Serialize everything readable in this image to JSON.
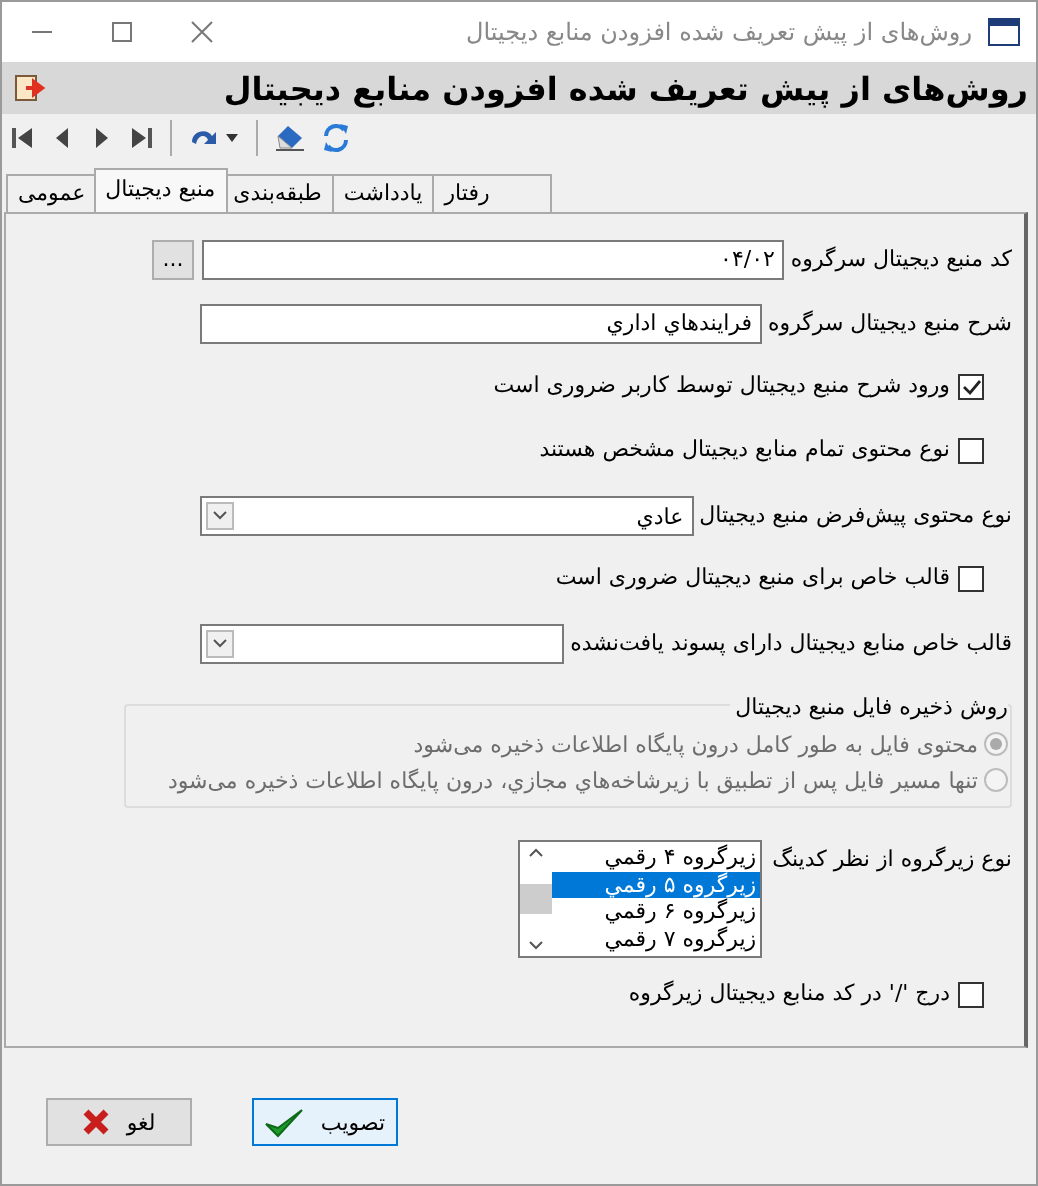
{
  "window": {
    "title": "روش‌های از پیش تعریف شده افزودن منابع دیجیتال"
  },
  "header": {
    "title": "روش‌های از پیش تعریف شده افزودن منابع دیجیتال"
  },
  "tabs": [
    {
      "label": "رفتار",
      "selected": false
    },
    {
      "label": "یادداشت",
      "selected": false
    },
    {
      "label": "طبقه‌بندی",
      "selected": false
    },
    {
      "label": "منبع دیجیتال",
      "selected": true
    },
    {
      "label": "عمومی",
      "selected": false
    }
  ],
  "fields": [
    {
      "kind": "text",
      "label": "کد منبع دیجیتال سرگروه",
      "value": "۰۴/۰۲",
      "browse": "..."
    },
    {
      "kind": "text",
      "label": "شرح منبع دیجیتال سرگروه",
      "value": "فرایندهاي اداري"
    },
    {
      "kind": "checkbox",
      "label": "ورود شرح منبع دیجیتال توسط کاربر ضروری است",
      "checked": true
    },
    {
      "kind": "checkbox",
      "label": "نوع محتوی تمام منابع دیجیتال مشخص هستند",
      "checked": false
    },
    {
      "kind": "combo",
      "label": "نوع محتوی پیش‌فرض منبع دیجیتال",
      "value": "عادي"
    },
    {
      "kind": "checkbox",
      "label": "قالب خاص برای منبع دیجیتال ضروری است",
      "checked": false
    },
    {
      "kind": "combo",
      "label": "قالب خاص منابع دیجیتال دارای پسوند یافت‌نشده"
    },
    {
      "kind": "radio_group",
      "label": "روش ذخیره فایل منبع دیجیتال",
      "disabled": true,
      "options": [
        {
          "label": "محتوی فایل به طور کامل درون پایگاه اطلاعات ذخیره می‌شود",
          "selected": true
        },
        {
          "label": "تنها مسیر فایل پس از تطبیق با زیرشاخه‌هاي مجازي، درون پایگاه اطلاعات ذخیره می‌شود",
          "selected": false
        }
      ]
    },
    {
      "kind": "list",
      "label": "نوع زیرگروه از نظر کدینگ",
      "items": [
        {
          "label": "زیرگروه ۴ رقمي",
          "selected": false
        },
        {
          "label": "زیرگروه ۵ رقمي",
          "selected": true
        },
        {
          "label": "زیرگروه ۶ رقمي",
          "selected": false
        },
        {
          "label": "زیرگروه ۷ رقمي",
          "selected": false
        }
      ]
    },
    {
      "kind": "checkbox",
      "label": "درج '/' در کد منابع دیجیتال زیرگروه",
      "checked": false
    }
  ],
  "buttons": [
    {
      "kind": "ok",
      "label": "تصویب",
      "default": true
    },
    {
      "kind": "cancel",
      "label": "لغو",
      "default": false
    }
  ]
}
